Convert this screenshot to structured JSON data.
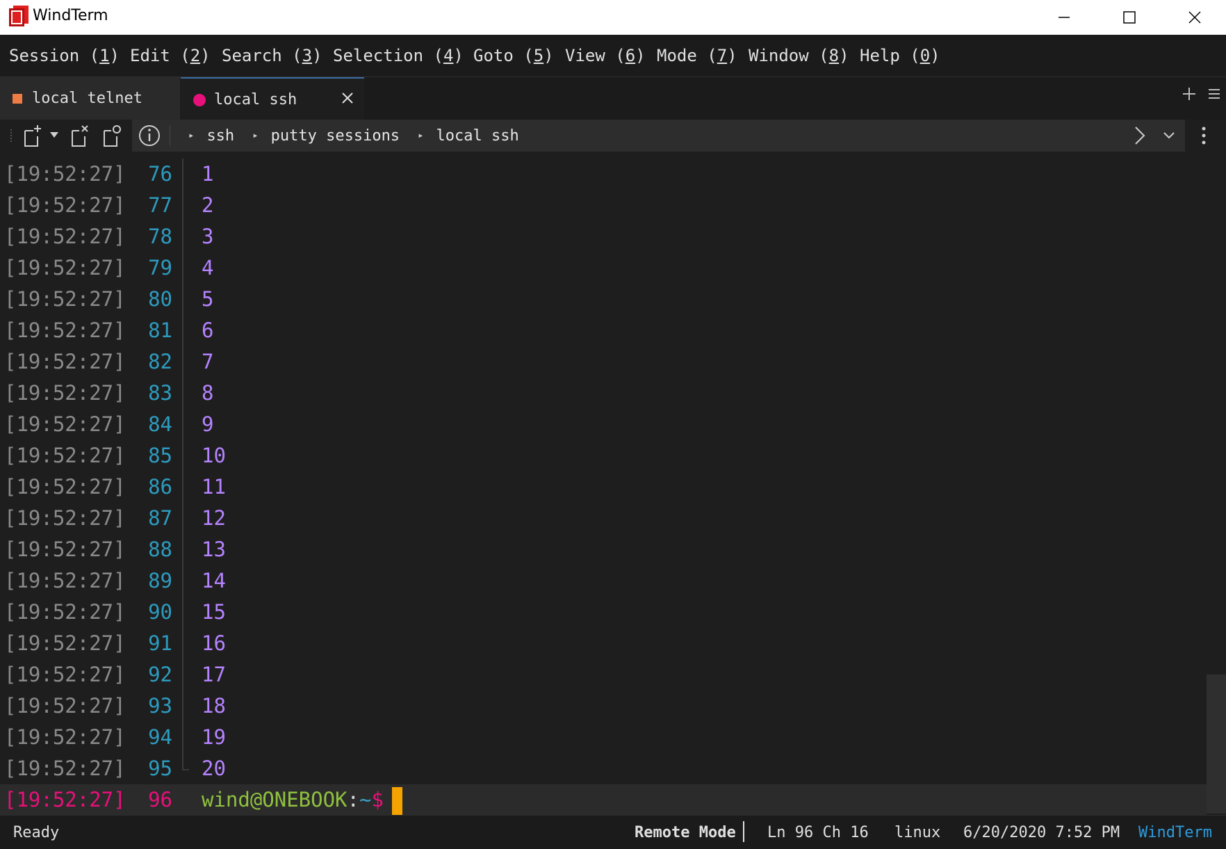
{
  "window": {
    "title": "WindTerm",
    "icon": "windterm-logo-icon",
    "controls": [
      "minimize-icon",
      "maximize-icon",
      "close-icon"
    ]
  },
  "menu": [
    {
      "label": "Session",
      "key": "1"
    },
    {
      "label": "Edit",
      "key": "2"
    },
    {
      "label": "Search",
      "key": "3"
    },
    {
      "label": "Selection",
      "key": "4"
    },
    {
      "label": "Goto",
      "key": "5"
    },
    {
      "label": "View",
      "key": "6"
    },
    {
      "label": "Mode",
      "key": "7"
    },
    {
      "label": "Window",
      "key": "8"
    },
    {
      "label": "Help",
      "key": "0"
    }
  ],
  "tabs": [
    {
      "label": "local telnet",
      "color": "#ef7b45",
      "active": false
    },
    {
      "label": "local ssh",
      "color": "#e8107a",
      "active": true
    }
  ],
  "breadcrumb": [
    "ssh",
    "putty sessions",
    "local ssh"
  ],
  "terminal": {
    "lines": [
      {
        "time": "[19:52:27]",
        "num": "76",
        "text": "1"
      },
      {
        "time": "[19:52:27]",
        "num": "77",
        "text": "2"
      },
      {
        "time": "[19:52:27]",
        "num": "78",
        "text": "3"
      },
      {
        "time": "[19:52:27]",
        "num": "79",
        "text": "4"
      },
      {
        "time": "[19:52:27]",
        "num": "80",
        "text": "5"
      },
      {
        "time": "[19:52:27]",
        "num": "81",
        "text": "6"
      },
      {
        "time": "[19:52:27]",
        "num": "82",
        "text": "7"
      },
      {
        "time": "[19:52:27]",
        "num": "83",
        "text": "8"
      },
      {
        "time": "[19:52:27]",
        "num": "84",
        "text": "9"
      },
      {
        "time": "[19:52:27]",
        "num": "85",
        "text": "10"
      },
      {
        "time": "[19:52:27]",
        "num": "86",
        "text": "11"
      },
      {
        "time": "[19:52:27]",
        "num": "87",
        "text": "12"
      },
      {
        "time": "[19:52:27]",
        "num": "88",
        "text": "13"
      },
      {
        "time": "[19:52:27]",
        "num": "89",
        "text": "14"
      },
      {
        "time": "[19:52:27]",
        "num": "90",
        "text": "15"
      },
      {
        "time": "[19:52:27]",
        "num": "91",
        "text": "16"
      },
      {
        "time": "[19:52:27]",
        "num": "92",
        "text": "17"
      },
      {
        "time": "[19:52:27]",
        "num": "93",
        "text": "18"
      },
      {
        "time": "[19:52:27]",
        "num": "94",
        "text": "19"
      },
      {
        "time": "[19:52:27]",
        "num": "95",
        "text": "20"
      }
    ],
    "current": {
      "time": "[19:52:27]",
      "num": "96",
      "user_host": "wind@ONEBOOK",
      "colon": ":",
      "path": "~",
      "dollar": "$"
    }
  },
  "status": {
    "ready": "Ready",
    "mode": "Remote Mode",
    "position": "Ln 96 Ch 16",
    "os": "linux",
    "datetime": "6/20/2020 7:52 PM",
    "brand": "WindTerm"
  }
}
